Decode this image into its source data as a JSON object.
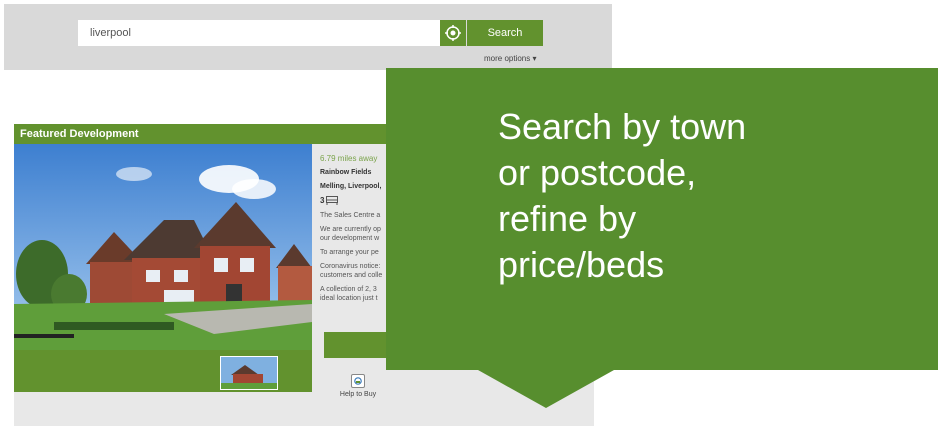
{
  "search": {
    "value": "liverpool",
    "button_label": "Search",
    "more_options": "more options ▾"
  },
  "feature": {
    "header": "Featured Development",
    "distance": "6.79 miles away",
    "name": "Rainbow Fields",
    "location": "Melling, Liverpool,",
    "beds": "3",
    "paragraphs": [
      "The Sales Centre a",
      "We are currently op",
      "our development w",
      "To arrange your pe",
      "Coronavirus notice:",
      "customers and colle",
      "A collection of 2, 3",
      "ideal location just t"
    ],
    "help_to_buy": "Help to Buy"
  },
  "callout": {
    "lines": [
      "Search by town",
      "or postcode,",
      "refine by",
      "price/beds"
    ]
  },
  "colors": {
    "brand_green": "#62922e",
    "callout_green": "#578e2e",
    "panel_grey": "#d9d9d9"
  }
}
